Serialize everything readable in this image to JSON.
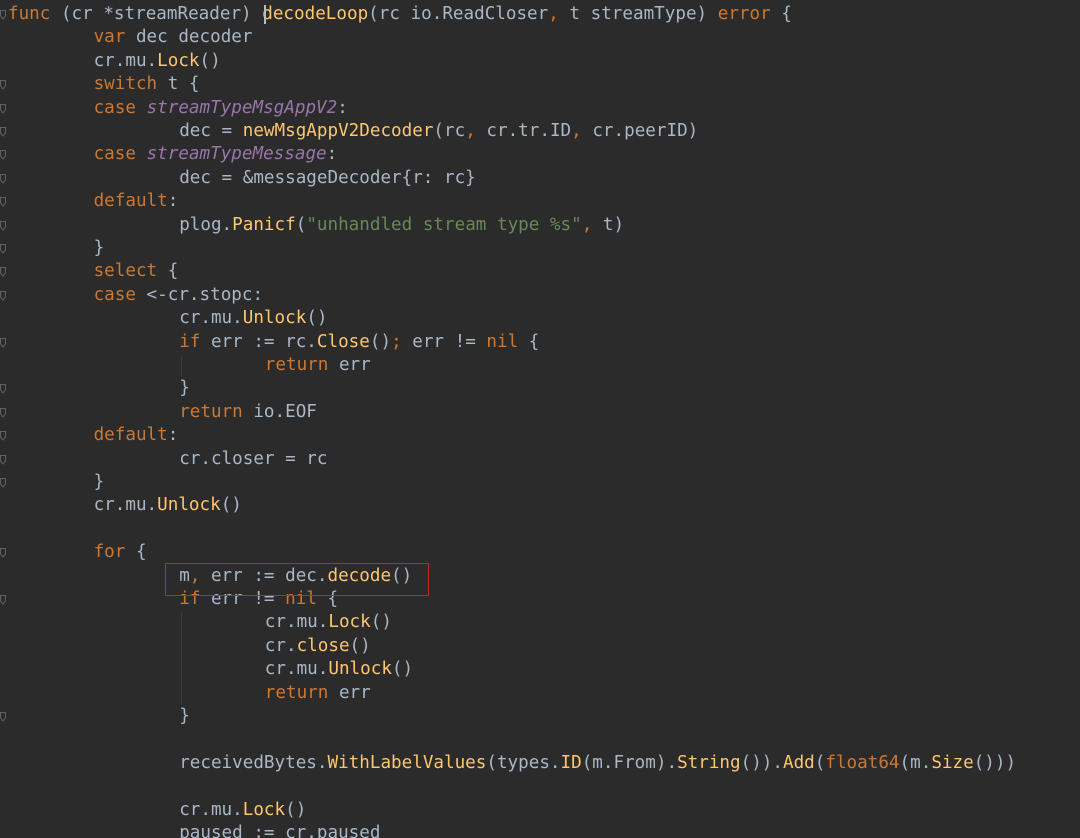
{
  "code": {
    "lines": [
      {
        "indent": 0,
        "fold": true,
        "tokens": [
          {
            "t": "func",
            "c": "kw"
          },
          {
            "t": " (cr *streamReader) ",
            "c": "txt"
          },
          {
            "t": "decodeLoop",
            "c": "fn"
          },
          {
            "t": "(rc io.ReadCloser",
            "c": "txt"
          },
          {
            "t": ",",
            "c": "kw"
          },
          {
            "t": " t streamType) ",
            "c": "txt"
          },
          {
            "t": "error",
            "c": "kw"
          },
          {
            "t": " {",
            "c": "txt"
          }
        ]
      },
      {
        "indent": 1,
        "fold": false,
        "tokens": [
          {
            "t": "var",
            "c": "kw"
          },
          {
            "t": " dec decoder",
            "c": "txt"
          }
        ]
      },
      {
        "indent": 1,
        "fold": false,
        "tokens": [
          {
            "t": "cr.mu.",
            "c": "txt"
          },
          {
            "t": "Lock",
            "c": "fn"
          },
          {
            "t": "()",
            "c": "txt"
          }
        ]
      },
      {
        "indent": 1,
        "fold": true,
        "tokens": [
          {
            "t": "switch",
            "c": "kw"
          },
          {
            "t": " t {",
            "c": "txt"
          }
        ]
      },
      {
        "indent": 1,
        "fold": true,
        "tokens": [
          {
            "t": "case",
            "c": "kw"
          },
          {
            "t": " ",
            "c": "txt"
          },
          {
            "t": "streamTypeMsgAppV2",
            "c": "cst"
          },
          {
            "t": ":",
            "c": "txt"
          }
        ]
      },
      {
        "indent": 2,
        "fold": true,
        "tokens": [
          {
            "t": "dec = ",
            "c": "txt"
          },
          {
            "t": "newMsgAppV2Decoder",
            "c": "fn"
          },
          {
            "t": "(rc",
            "c": "txt"
          },
          {
            "t": ",",
            "c": "kw"
          },
          {
            "t": " cr.tr.ID",
            "c": "txt"
          },
          {
            "t": ",",
            "c": "kw"
          },
          {
            "t": " cr.peerID)",
            "c": "txt"
          }
        ]
      },
      {
        "indent": 1,
        "fold": true,
        "tokens": [
          {
            "t": "case",
            "c": "kw"
          },
          {
            "t": " ",
            "c": "txt"
          },
          {
            "t": "streamTypeMessage",
            "c": "cst"
          },
          {
            "t": ":",
            "c": "txt"
          }
        ]
      },
      {
        "indent": 2,
        "fold": true,
        "tokens": [
          {
            "t": "dec = &messageDecoder{r: rc}",
            "c": "txt"
          }
        ]
      },
      {
        "indent": 1,
        "fold": true,
        "tokens": [
          {
            "t": "default",
            "c": "kw"
          },
          {
            "t": ":",
            "c": "txt"
          }
        ]
      },
      {
        "indent": 2,
        "fold": true,
        "tokens": [
          {
            "t": "plog.",
            "c": "txt"
          },
          {
            "t": "Panicf",
            "c": "fn"
          },
          {
            "t": "(",
            "c": "txt"
          },
          {
            "t": "\"unhandled stream type %s\"",
            "c": "str"
          },
          {
            "t": ",",
            "c": "kw"
          },
          {
            "t": " t)",
            "c": "txt"
          }
        ]
      },
      {
        "indent": 1,
        "fold": true,
        "tokens": [
          {
            "t": "}",
            "c": "txt"
          }
        ]
      },
      {
        "indent": 1,
        "fold": true,
        "tokens": [
          {
            "t": "select",
            "c": "kw"
          },
          {
            "t": " {",
            "c": "txt"
          }
        ]
      },
      {
        "indent": 1,
        "fold": true,
        "tokens": [
          {
            "t": "case",
            "c": "kw"
          },
          {
            "t": " <-cr.stopc:",
            "c": "txt"
          }
        ]
      },
      {
        "indent": 2,
        "fold": false,
        "tokens": [
          {
            "t": "cr.mu.",
            "c": "txt"
          },
          {
            "t": "Unlock",
            "c": "fn"
          },
          {
            "t": "()",
            "c": "txt"
          }
        ]
      },
      {
        "indent": 2,
        "fold": true,
        "tokens": [
          {
            "t": "if",
            "c": "kw"
          },
          {
            "t": " err := rc.",
            "c": "txt"
          },
          {
            "t": "Close",
            "c": "fn"
          },
          {
            "t": "()",
            "c": "txt"
          },
          {
            "t": ";",
            "c": "kw"
          },
          {
            "t": " err != ",
            "c": "txt"
          },
          {
            "t": "nil",
            "c": "kw"
          },
          {
            "t": " {",
            "c": "txt"
          }
        ]
      },
      {
        "indent": 3,
        "fold": false,
        "tokens": [
          {
            "t": "return",
            "c": "kw"
          },
          {
            "t": " err",
            "c": "txt"
          }
        ]
      },
      {
        "indent": 2,
        "fold": true,
        "tokens": [
          {
            "t": "}",
            "c": "txt"
          }
        ]
      },
      {
        "indent": 2,
        "fold": true,
        "tokens": [
          {
            "t": "return",
            "c": "kw"
          },
          {
            "t": " io.EOF",
            "c": "txt"
          }
        ]
      },
      {
        "indent": 1,
        "fold": true,
        "tokens": [
          {
            "t": "default",
            "c": "kw"
          },
          {
            "t": ":",
            "c": "txt"
          }
        ]
      },
      {
        "indent": 2,
        "fold": true,
        "tokens": [
          {
            "t": "cr.closer = rc",
            "c": "txt"
          }
        ]
      },
      {
        "indent": 1,
        "fold": true,
        "tokens": [
          {
            "t": "}",
            "c": "txt"
          }
        ]
      },
      {
        "indent": 1,
        "fold": false,
        "tokens": [
          {
            "t": "cr.mu.",
            "c": "txt"
          },
          {
            "t": "Unlock",
            "c": "fn"
          },
          {
            "t": "()",
            "c": "txt"
          }
        ]
      },
      {
        "indent": 0,
        "fold": false,
        "tokens": []
      },
      {
        "indent": 1,
        "fold": true,
        "tokens": [
          {
            "t": "for",
            "c": "kw"
          },
          {
            "t": " {",
            "c": "txt"
          }
        ]
      },
      {
        "indent": 2,
        "fold": false,
        "tokens": [
          {
            "t": "m",
            "c": "txt"
          },
          {
            "t": ",",
            "c": "kw"
          },
          {
            "t": " err := dec.",
            "c": "txt"
          },
          {
            "t": "decode",
            "c": "fn"
          },
          {
            "t": "()",
            "c": "txt"
          }
        ]
      },
      {
        "indent": 2,
        "fold": true,
        "tokens": [
          {
            "t": "if",
            "c": "kw"
          },
          {
            "t": " err != ",
            "c": "txt"
          },
          {
            "t": "nil",
            "c": "kw"
          },
          {
            "t": " {",
            "c": "txt"
          }
        ]
      },
      {
        "indent": 3,
        "fold": false,
        "tokens": [
          {
            "t": "cr.mu.",
            "c": "txt"
          },
          {
            "t": "Lock",
            "c": "fn"
          },
          {
            "t": "()",
            "c": "txt"
          }
        ]
      },
      {
        "indent": 3,
        "fold": false,
        "tokens": [
          {
            "t": "cr.",
            "c": "txt"
          },
          {
            "t": "close",
            "c": "fn"
          },
          {
            "t": "()",
            "c": "txt"
          }
        ]
      },
      {
        "indent": 3,
        "fold": false,
        "tokens": [
          {
            "t": "cr.mu.",
            "c": "txt"
          },
          {
            "t": "Unlock",
            "c": "fn"
          },
          {
            "t": "()",
            "c": "txt"
          }
        ]
      },
      {
        "indent": 3,
        "fold": false,
        "tokens": [
          {
            "t": "return",
            "c": "kw"
          },
          {
            "t": " err",
            "c": "txt"
          }
        ]
      },
      {
        "indent": 2,
        "fold": true,
        "tokens": [
          {
            "t": "}",
            "c": "txt"
          }
        ]
      },
      {
        "indent": 0,
        "fold": false,
        "tokens": []
      },
      {
        "indent": 2,
        "fold": false,
        "tokens": [
          {
            "t": "receivedBytes.",
            "c": "txt"
          },
          {
            "t": "WithLabelValues",
            "c": "fn"
          },
          {
            "t": "(types.",
            "c": "txt"
          },
          {
            "t": "ID",
            "c": "fn"
          },
          {
            "t": "(m.From).",
            "c": "txt"
          },
          {
            "t": "String",
            "c": "fn"
          },
          {
            "t": "()).",
            "c": "txt"
          },
          {
            "t": "Add",
            "c": "fn"
          },
          {
            "t": "(",
            "c": "txt"
          },
          {
            "t": "float64",
            "c": "kw"
          },
          {
            "t": "(m.",
            "c": "txt"
          },
          {
            "t": "Size",
            "c": "fn"
          },
          {
            "t": "()))",
            "c": "txt"
          }
        ]
      },
      {
        "indent": 0,
        "fold": false,
        "tokens": []
      },
      {
        "indent": 2,
        "fold": false,
        "tokens": [
          {
            "t": "cr.mu.",
            "c": "txt"
          },
          {
            "t": "Lock",
            "c": "fn"
          },
          {
            "t": "()",
            "c": "txt"
          }
        ]
      },
      {
        "indent": 2,
        "fold": false,
        "tokens": [
          {
            "t": "paused := cr.paused",
            "c": "txt"
          }
        ]
      }
    ]
  },
  "colors": {
    "background": "#2b2b2b",
    "keyword": "#cc7832",
    "function": "#ffc66d",
    "constant": "#9876aa",
    "string": "#6a8759",
    "text": "#a9b7c6",
    "highlight_box": "#c1272d"
  }
}
